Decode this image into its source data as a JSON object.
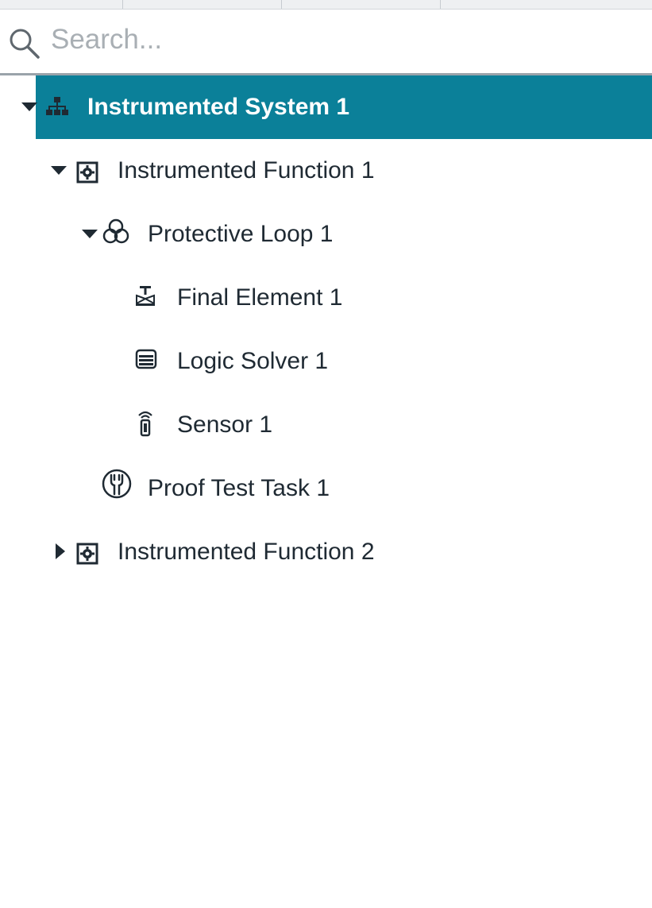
{
  "search": {
    "placeholder": "Search...",
    "value": ""
  },
  "colors": {
    "selection": "#0b8099",
    "text": "#1f2a33",
    "placeholder": "#a9afb4"
  },
  "tree": [
    {
      "label": "Instrumented System 1",
      "icon": "hierarchy-icon",
      "expanded": true,
      "selected": true,
      "level": 0
    },
    {
      "label": "Instrumented Function 1",
      "icon": "function-gear-icon",
      "expanded": true,
      "selected": false,
      "level": 1
    },
    {
      "label": "Protective Loop 1",
      "icon": "loop-knot-icon",
      "expanded": true,
      "selected": false,
      "level": 2
    },
    {
      "label": "Final Element 1",
      "icon": "valve-icon",
      "selected": false,
      "level": 3
    },
    {
      "label": "Logic Solver 1",
      "icon": "logic-solver-icon",
      "selected": false,
      "level": 3
    },
    {
      "label": "Sensor 1",
      "icon": "sensor-icon",
      "selected": false,
      "level": 3
    },
    {
      "label": "Proof Test Task 1",
      "icon": "wrench-circle-icon",
      "selected": false,
      "level": 2
    },
    {
      "label": "Instrumented Function 2",
      "icon": "function-gear-icon",
      "expanded": false,
      "selected": false,
      "level": 1
    }
  ]
}
